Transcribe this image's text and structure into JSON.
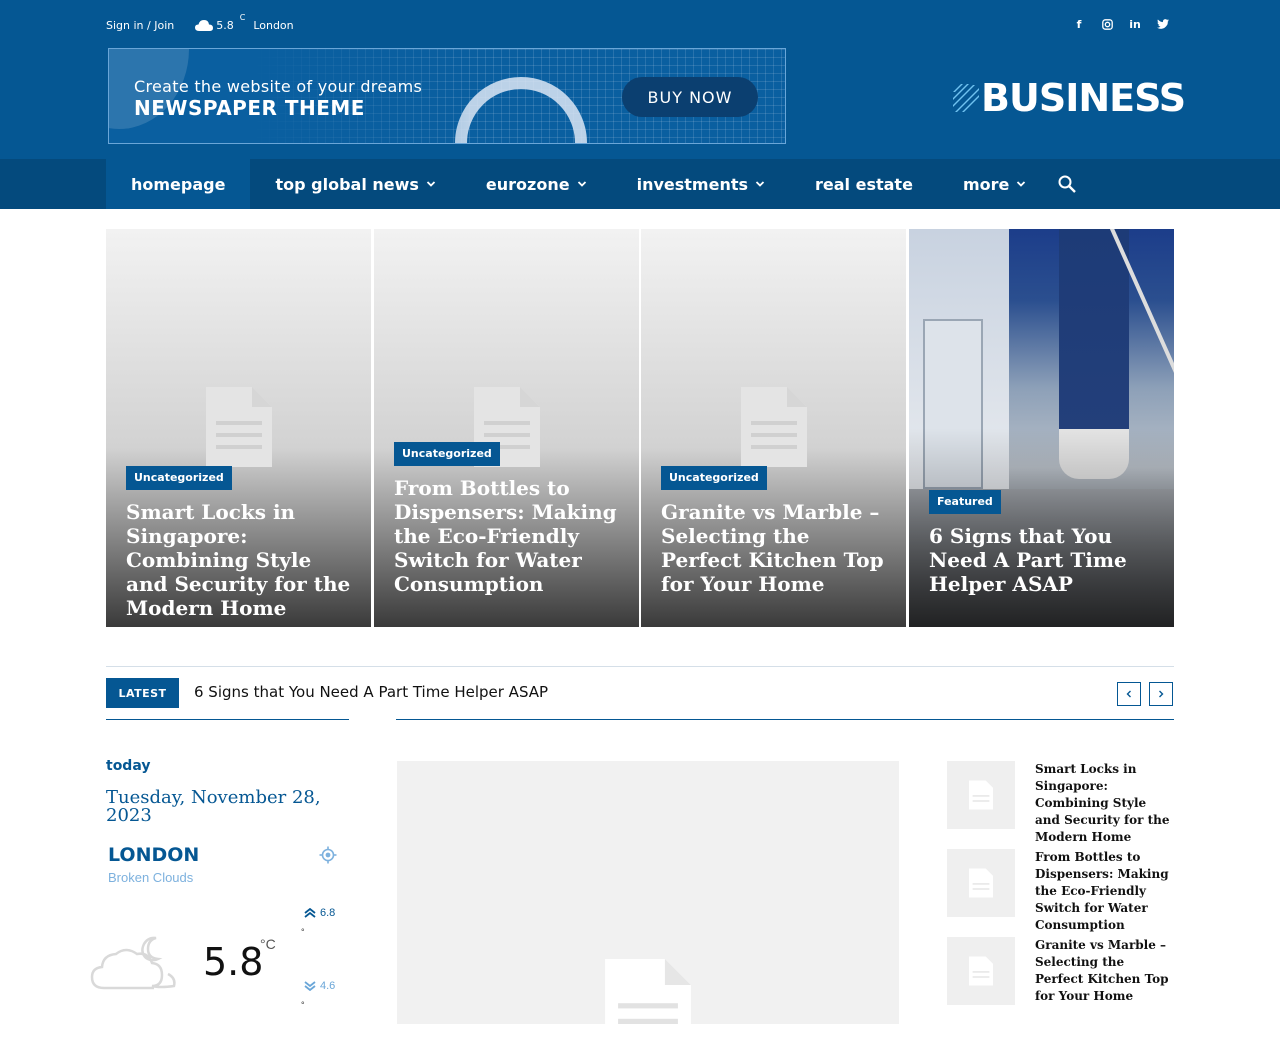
{
  "topbar": {
    "signin": "Sign in / Join",
    "temp": "5.8",
    "unit": "C",
    "city": "London",
    "socials": [
      "facebook-icon",
      "instagram-icon",
      "linkedin-icon",
      "twitter-icon"
    ]
  },
  "banner": {
    "line1": "Create the website of your dreams",
    "line2": "NEWSPAPER THEME",
    "button": "BUY NOW"
  },
  "logo": {
    "text": "BUSINESS"
  },
  "nav": {
    "items": [
      {
        "label": "homepage"
      },
      {
        "label": "top global news"
      },
      {
        "label": "eurozone"
      },
      {
        "label": "investments"
      },
      {
        "label": "real estate"
      },
      {
        "label": "more"
      }
    ]
  },
  "hero": [
    {
      "category": "Uncategorized",
      "title": "Smart Locks in Singapore: Combining Style and Security for the Modern Home"
    },
    {
      "category": "Uncategorized",
      "title": "From Bottles to Dispensers: Making the Eco-Friendly Switch for Water Consumption"
    },
    {
      "category": "Uncategorized",
      "title": "Granite vs Marble – Selecting the Perfect Kitchen Top for Your Home"
    },
    {
      "category": "Featured",
      "title": "6 Signs that You Need A Part Time Helper ASAP"
    }
  ],
  "ticker": {
    "label": "LATEST",
    "headline": "6 Signs that You Need A Part Time Helper ASAP"
  },
  "weather": {
    "today": "today",
    "date": "Tuesday, November 28, 2023",
    "city": "LONDON",
    "desc": "Broken Clouds",
    "temp": "5.8",
    "unit": "°C",
    "high": "6.8",
    "low": "4.6",
    "deg": "°"
  },
  "sidelist": [
    {
      "title": "Smart Locks in Singapore: Combining Style and Security for the Modern Home"
    },
    {
      "title": "From Bottles to Dispensers: Making the Eco-Friendly Switch for Water Consumption"
    },
    {
      "title": "Granite vs Marble – Selecting the Perfect Kitchen Top for Your Home"
    }
  ],
  "colors": {
    "primary": "#055793",
    "nav": "#044a7d",
    "accent_light": "#7db1de"
  }
}
